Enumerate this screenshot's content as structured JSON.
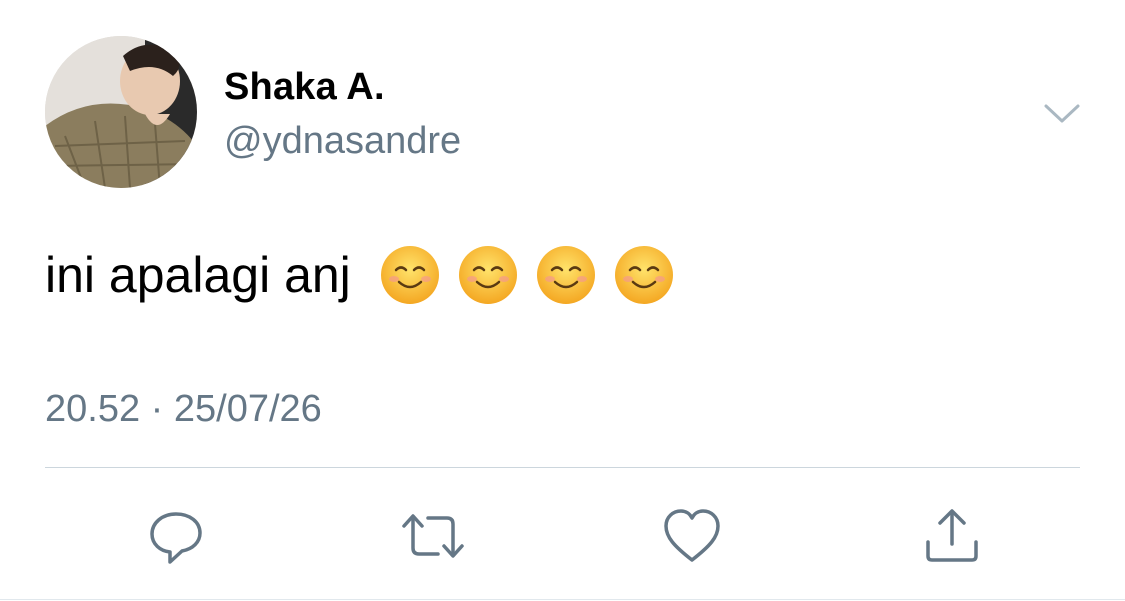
{
  "tweet": {
    "display_name": "Shaka A.",
    "handle": "@ydnasandre",
    "text": "ini apalagi anj",
    "emojis": [
      "smiling-face",
      "smiling-face",
      "smiling-face",
      "smiling-face"
    ],
    "time": "20.52",
    "separator": "·",
    "date": "25/07/26",
    "meta_line": "20.52 · 25/07/26"
  },
  "icons": {
    "more": "chevron-down-icon",
    "reply": "reply-icon",
    "retweet": "retweet-icon",
    "like": "heart-icon",
    "share": "share-icon"
  },
  "colors": {
    "text_primary": "#000000",
    "text_secondary": "#657786",
    "icon": "#657786",
    "divider": "#ccd6dd",
    "emoji_face": "#fbc02d"
  }
}
